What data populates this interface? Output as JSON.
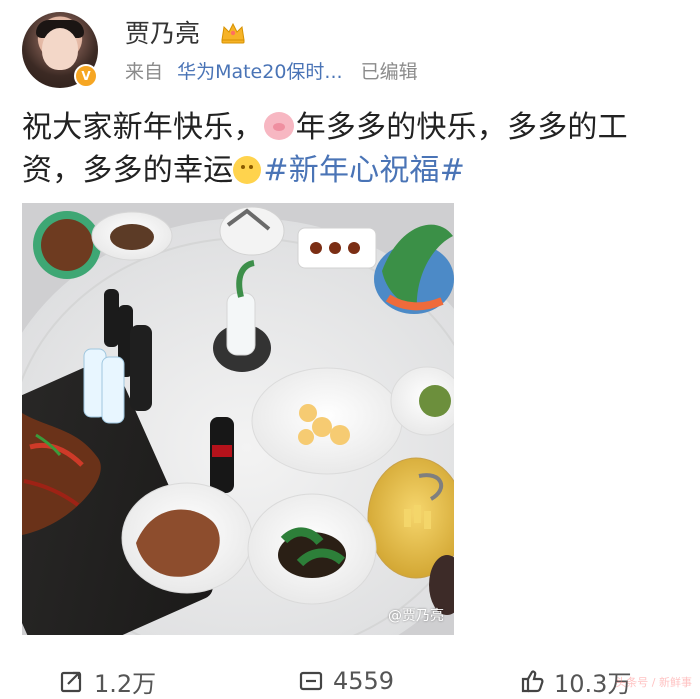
{
  "header": {
    "username": "贾乃亮",
    "meta_prefix": "来自",
    "meta_source": "华为Mate20保时...",
    "meta_edited": "已编辑"
  },
  "post": {
    "segment_1": "祝大家新年快乐，",
    "segment_2": "年多多的快乐，多多的工资，多多的幸运",
    "hashtag": "#新年心祝福#"
  },
  "photo": {
    "watermark": "@贾乃亮"
  },
  "actions": {
    "repost_count": "1.2万",
    "comment_count": "4559",
    "like_count": "10.3万"
  },
  "icons": {
    "crown": "crown-icon",
    "repost": "repost-icon",
    "comment": "comment-icon",
    "like": "thumb-up-icon",
    "pig": "pig-emoji-icon",
    "smile": "smile-emoji-icon"
  },
  "colors": {
    "accent_blue": "#4a74b6",
    "crown_gold": "#f6b327",
    "verify_orange": "#f6a623"
  },
  "corner_watermark": "头条号 / 新鲜事"
}
